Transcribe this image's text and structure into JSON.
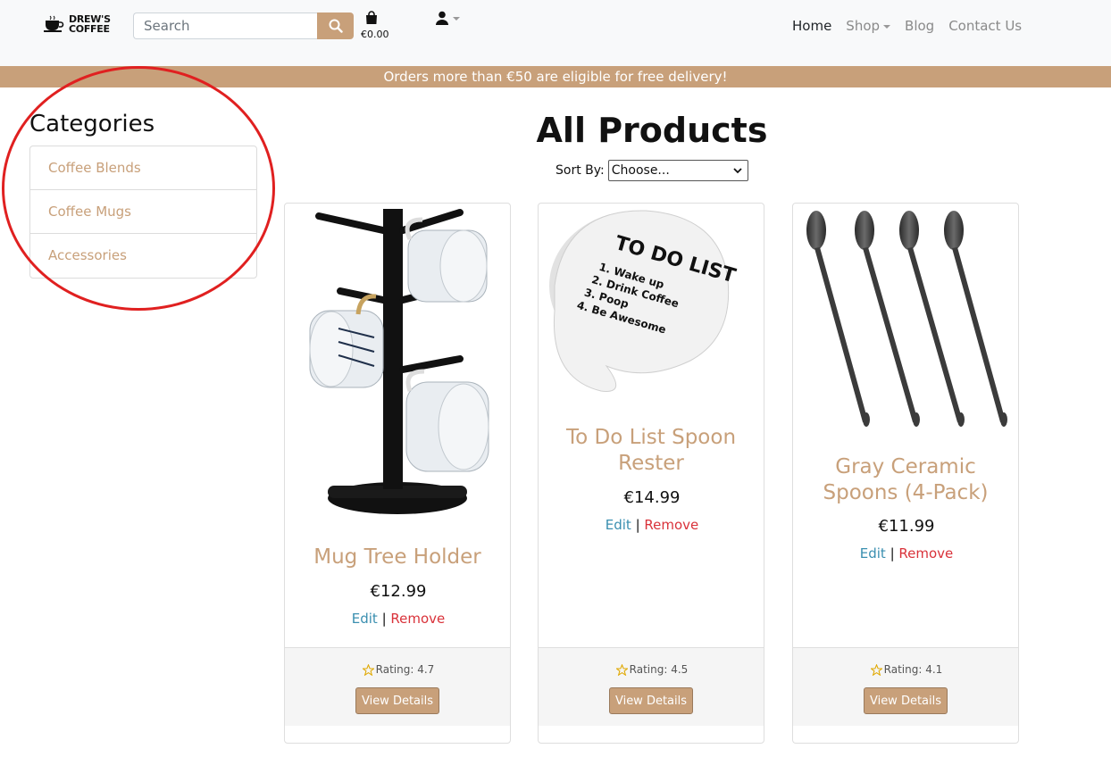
{
  "brand": {
    "line1": "DREW'S",
    "line2": "COFFEE"
  },
  "search": {
    "placeholder": "Search"
  },
  "bag": {
    "total": "€0.00"
  },
  "nav": {
    "home": "Home",
    "shop": "Shop",
    "blog": "Blog",
    "contact": "Contact Us"
  },
  "banner": {
    "text": "Orders more than €50 are eligible for free delivery!"
  },
  "sidebar": {
    "title": "Categories",
    "items": [
      {
        "label": "Coffee Blends"
      },
      {
        "label": "Coffee Mugs"
      },
      {
        "label": "Accessories"
      }
    ]
  },
  "main": {
    "title": "All Products",
    "sort_label": "Sort By:",
    "sort_value": "Choose..."
  },
  "products": [
    {
      "name_lines": [
        "Mug Tree Holder"
      ],
      "price": "€12.99",
      "edit": "Edit",
      "sep": "|",
      "remove": "Remove",
      "rating": "Rating: 4.7",
      "button": "View Details",
      "image": "mug-tree-holder-image"
    },
    {
      "name_lines": [
        "To Do List Spoon",
        "Rester"
      ],
      "price": "€14.99",
      "edit": "Edit",
      "sep": "|",
      "remove": "Remove",
      "rating": "Rating: 4.5",
      "button": "View Details",
      "image": "spoon-rester-image",
      "image_text": {
        "title": "TO DO LIST",
        "items": [
          "1. Wake up",
          "2. Drink Coffee",
          "3. Poop",
          "4. Be Awesome"
        ]
      }
    },
    {
      "name_lines": [
        "Gray Ceramic",
        "Spoons (4-Pack)"
      ],
      "price": "€11.99",
      "edit": "Edit",
      "sep": "|",
      "remove": "Remove",
      "rating": "Rating: 4.1",
      "button": "View Details",
      "image": "gray-spoons-image"
    }
  ],
  "colors": {
    "accent": "#c8a07a",
    "edit": "#3a8fb0",
    "remove": "#d9323a",
    "annotation": "#e02020"
  }
}
